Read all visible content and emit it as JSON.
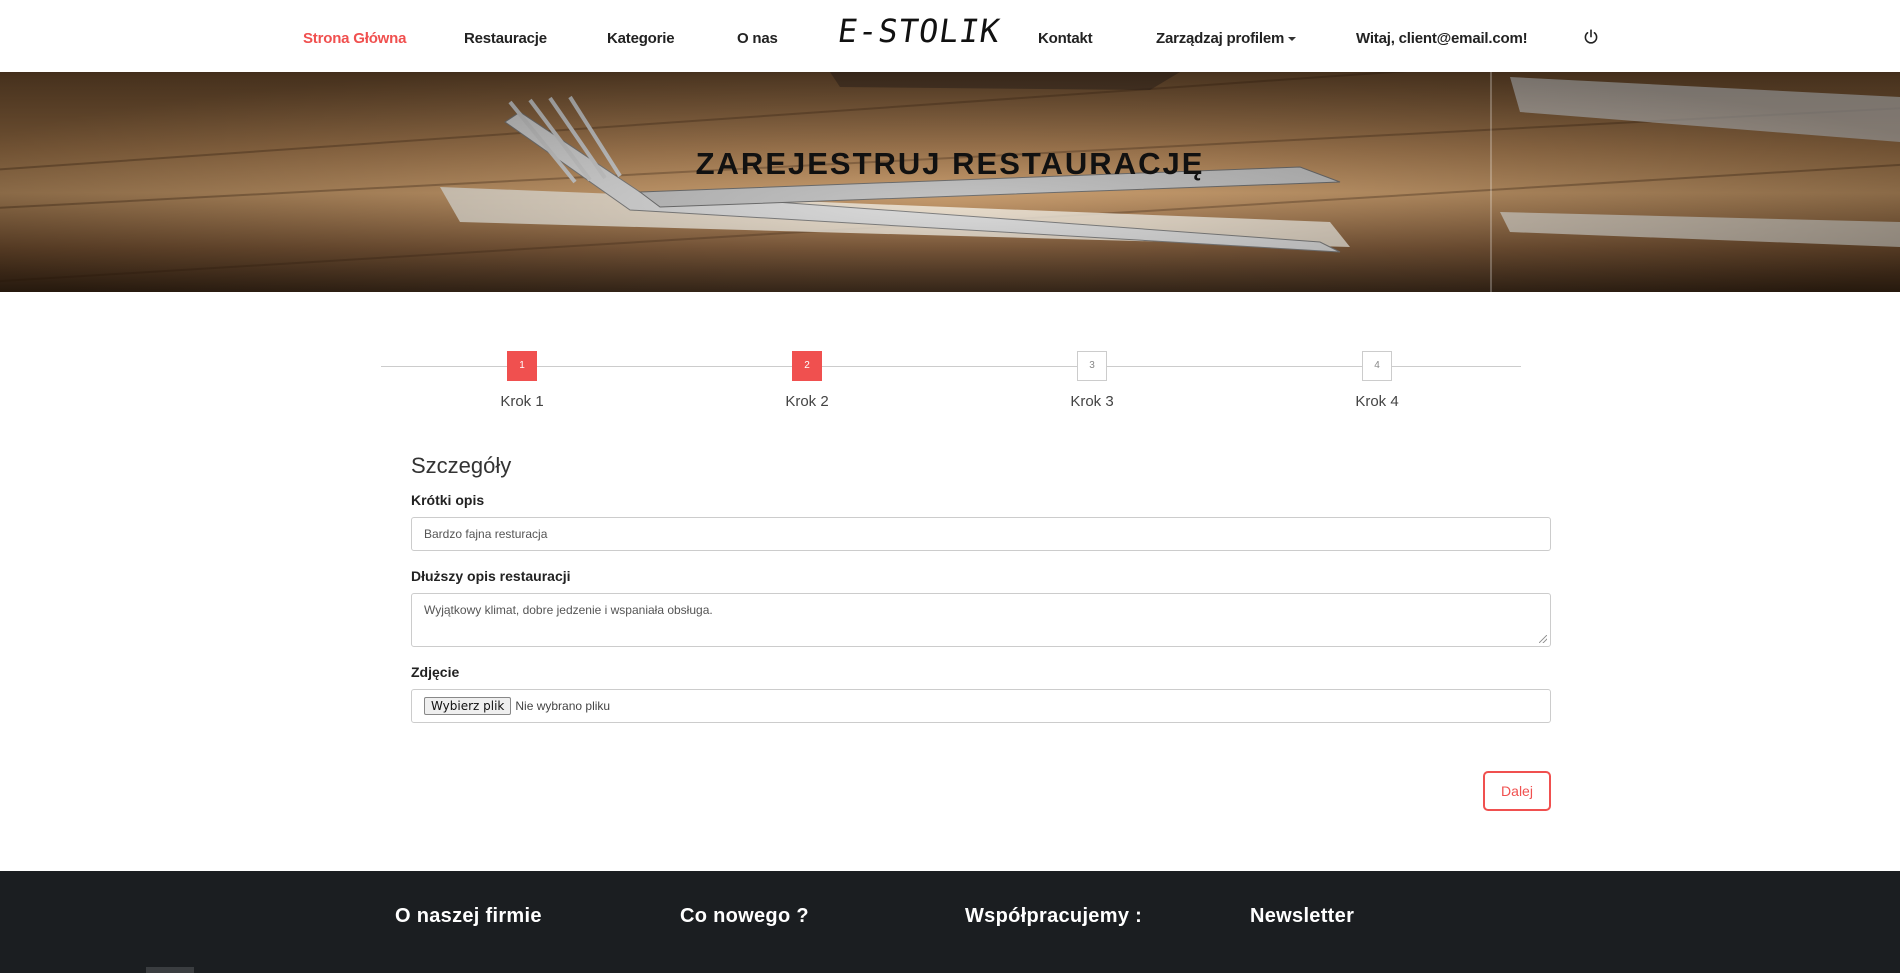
{
  "nav": {
    "home": "Strona Główna",
    "restaurants": "Restauracje",
    "categories": "Kategorie",
    "about": "O nas",
    "logo": "E-STOLIK",
    "contact": "Kontakt",
    "profile": "Zarządzaj profilem",
    "greeting": "Witaj, client@email.com!",
    "power_icon": "power-icon",
    "active_color": "#f0504f"
  },
  "hero": {
    "title": "ZAREJESTRUJ RESTAURACJĘ"
  },
  "steps": [
    {
      "number": "1",
      "label": "Krok 1",
      "done": true
    },
    {
      "number": "2",
      "label": "Krok 2",
      "done": true
    },
    {
      "number": "3",
      "label": "Krok 3",
      "done": false
    },
    {
      "number": "4",
      "label": "Krok 4",
      "done": false
    }
  ],
  "form": {
    "section_title": "Szczegóły",
    "short_desc_label": "Krótki opis",
    "short_desc_value": "Bardzo fajna resturacja",
    "long_desc_label": "Dłuższy opis restauracji",
    "long_desc_value": "Wyjątkowy klimat, dobre jedzenie i wspaniała obsługa.",
    "photo_label": "Zdjęcie",
    "file_button": "Wybierz plik",
    "file_status": "Nie wybrano pliku",
    "next_button": "Dalej"
  },
  "footer": {
    "about": "O naszej firmie",
    "news": "Co nowego ?",
    "partners": "Współpracujemy :",
    "newsletter": "Newsletter"
  }
}
